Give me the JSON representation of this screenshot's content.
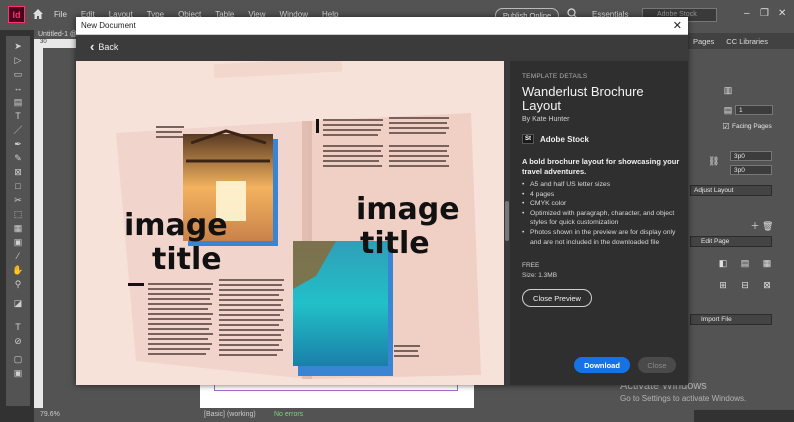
{
  "app": {
    "logo_text": "Id",
    "menu": [
      "File",
      "Edit",
      "Layout",
      "Type",
      "Object",
      "Table",
      "View",
      "Window",
      "Help"
    ],
    "publish_label": "Publish Online",
    "workspace_label": "Essentials",
    "stock_search_placeholder": "Adobe Stock",
    "doc_tab_label": "Untitled-1 @",
    "ruler_top_label": "30",
    "status_zoom": "79.6%",
    "status_profile": "[Basic] (working)",
    "status_errors": "No errors",
    "window_controls": [
      "–",
      "❐",
      "✕"
    ]
  },
  "right_panel": {
    "tabs": [
      "Pages",
      "CC Libraries"
    ],
    "facing_pages_label": "Facing Pages",
    "pages_value": "1",
    "margin_top": "3p0",
    "margin_bottom": "3p0",
    "adjust_layout_label": "Adjust Layout",
    "edit_page_label": "Edit Page",
    "import_file_label": "Import File"
  },
  "dialog": {
    "title": "New Document",
    "close_glyph": "✕",
    "back_label": "Back",
    "details": {
      "kicker": "TEMPLATE DETAILS",
      "title": "Wanderlust Brochure Layout",
      "by": "By Kate Hunter",
      "stock_badge": "St",
      "stock_label": "Adobe Stock",
      "description": "A bold brochure layout for showcasing your travel adventures.",
      "features": [
        "A5 and half US letter sizes",
        "4 pages",
        "CMYK color",
        "Optimized with paragraph, character, and object styles for quick customization",
        "Photos shown in the preview are for display only and are not included in the downloaded file"
      ],
      "price": "FREE",
      "size": "Size: 1.3MB",
      "close_preview_label": "Close Preview",
      "download_label": "Download",
      "close_label": "Close"
    },
    "preview": {
      "left_word_1": "image",
      "left_word_2": "title",
      "right_word_1": "image",
      "right_word_2": "title"
    }
  },
  "watermark": {
    "title": "Activate Windows",
    "subtitle": "Go to Settings to activate Windows."
  },
  "colors": {
    "accent": "#1473e6",
    "brochure_bg": "#f7e2da",
    "photo_blue": "#3f8fd8"
  }
}
